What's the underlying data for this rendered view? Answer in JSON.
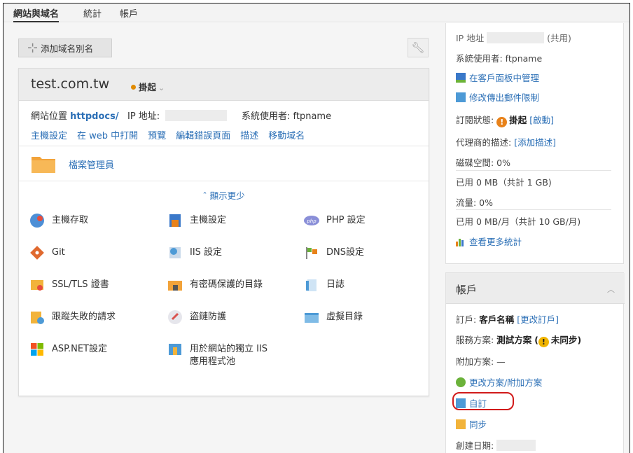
{
  "topnav": {
    "tabs": [
      "網站與域名",
      "統計",
      "帳戶"
    ]
  },
  "toolbar": {
    "add_alias_label": "添加域名別名"
  },
  "domain_card": {
    "domain": "test.com.tw",
    "status": "掛起",
    "location_label": "網站位置",
    "location_value": "httpdocs/",
    "ip_label": "IP 地址:",
    "sysuser_label": "系統使用者:",
    "sysuser_value": "ftpname",
    "links": [
      "主機設定",
      "在 web 中打開",
      "預覽",
      "編輯錯誤頁面",
      "描述",
      "移動域名"
    ],
    "file_manager": "檔案管理員",
    "show_less": "顯示更少",
    "tools": [
      "主機存取",
      "主機設定",
      "PHP 設定",
      "Git",
      "IIS 設定",
      "DNS設定",
      "SSL/TLS 證書",
      "有密碼保護的目錄",
      "日誌",
      "跟蹤失敗的請求",
      "盜鏈防護",
      "虛擬目錄",
      "ASP.NET設定",
      "用於網站的獨立 IIS 應用程式池"
    ]
  },
  "subscription": {
    "ip_label": "IP 地址",
    "ip_shared": "(共用)",
    "sysuser": "系統使用者: ftpname",
    "manage_in_panel": "在客戶面板中管理",
    "change_mail_limit": "修改傳出郵件限制",
    "status_label": "訂閱狀態:",
    "status_value": "掛起",
    "activate": "[啟動]",
    "reseller_desc_label": "代理商的描述:",
    "add_desc": "[添加描述]",
    "disk_label": "磁碟空間: 0%",
    "disk_used": "已用 0 MB（共計 1 GB)",
    "traffic_label": "流量: 0%",
    "traffic_used": "已用 0 MB/月（共計 10 GB/月)",
    "more_stats": "查看更多統計"
  },
  "account": {
    "title": "帳戶",
    "subscription_label": "訂戶:",
    "customer_name": "客戶名稱",
    "change_subscriber": "[更改訂戶]",
    "plan_label": "服務方案:",
    "plan_value": "測試方案",
    "plan_sync": "未同步",
    "addon_label": "附加方案: —",
    "change_plan": "更改方案/附加方案",
    "customize": "自訂",
    "sync": "同步",
    "created_label": "創建日期:"
  },
  "colors": {
    "link": "#2b6fb6",
    "warning": "#e8821a",
    "highlight": "#d11a1a"
  }
}
